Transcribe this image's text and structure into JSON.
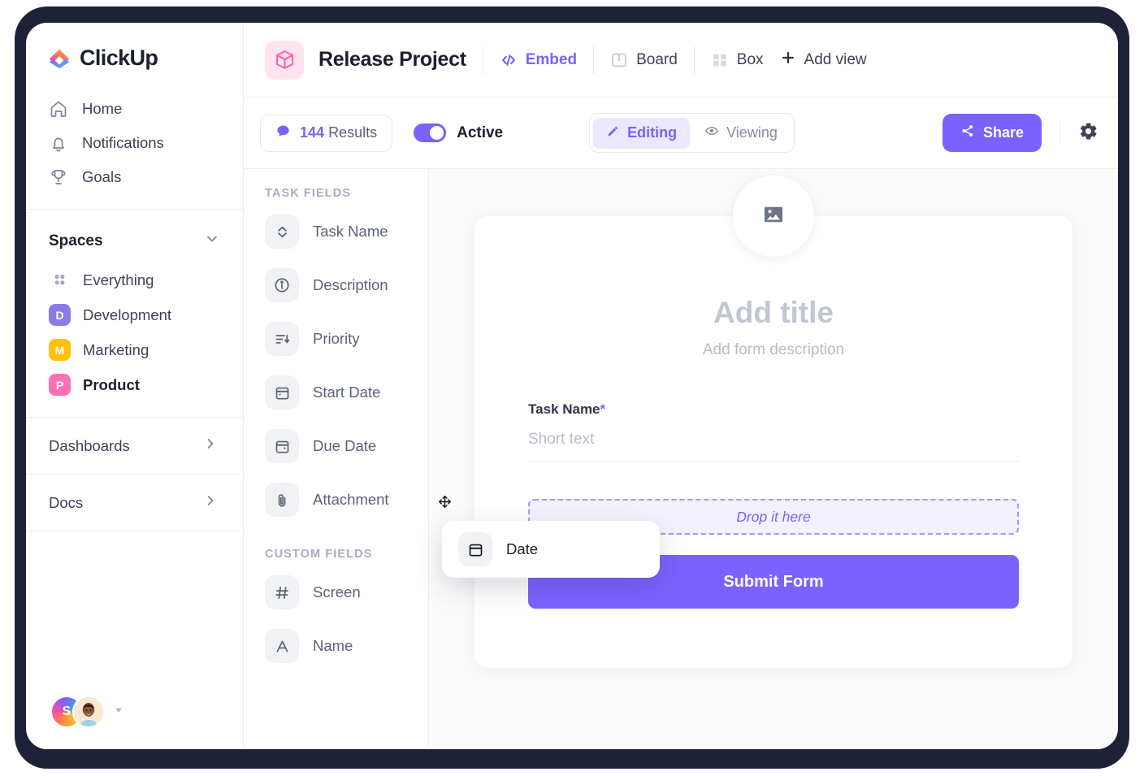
{
  "app": {
    "brand": "ClickUp"
  },
  "sidebar": {
    "nav": [
      {
        "label": "Home",
        "icon": "home-icon"
      },
      {
        "label": "Notifications",
        "icon": "bell-icon"
      },
      {
        "label": "Goals",
        "icon": "trophy-icon"
      }
    ],
    "spaces_title": "Spaces",
    "spaces": [
      {
        "label": "Everything",
        "badge": "",
        "color": "",
        "active": false,
        "icon": "grid-dots-icon"
      },
      {
        "label": "Development",
        "badge": "D",
        "color": "#8C7AE6",
        "active": false
      },
      {
        "label": "Marketing",
        "badge": "M",
        "color": "#FFC107",
        "active": false
      },
      {
        "label": "Product",
        "badge": "P",
        "color": "#FF6FB5",
        "active": true
      }
    ],
    "sections": [
      {
        "label": "Dashboards"
      },
      {
        "label": "Docs"
      }
    ],
    "avatars": {
      "initial": "S"
    }
  },
  "header": {
    "project_title": "Release Project",
    "views": [
      {
        "label": "Embed",
        "icon": "code-icon",
        "active": true
      },
      {
        "label": "Board",
        "icon": "board-icon",
        "active": false
      },
      {
        "label": "Box",
        "icon": "box-grid-icon",
        "active": false
      }
    ],
    "add_view": "Add view"
  },
  "toolbar": {
    "results_count": "144",
    "results_label": "Results",
    "active_label": "Active",
    "active_on": true,
    "modes": [
      {
        "label": "Editing",
        "icon": "pencil-icon",
        "active": true
      },
      {
        "label": "Viewing",
        "icon": "eye-icon",
        "active": false
      }
    ],
    "share_label": "Share"
  },
  "fields_panel": {
    "task_fields_title": "TASK FIELDS",
    "task_fields": [
      {
        "label": "Task Name",
        "icon": "chevron-updown-icon"
      },
      {
        "label": "Description",
        "icon": "info-circle-icon"
      },
      {
        "label": "Priority",
        "icon": "sort-desc-icon"
      },
      {
        "label": "Start Date",
        "icon": "calendar-icon"
      },
      {
        "label": "Due Date",
        "icon": "calendar-icon"
      },
      {
        "label": "Attachment",
        "icon": "paperclip-icon"
      }
    ],
    "custom_fields_title": "CUSTOM FIELDS",
    "custom_fields": [
      {
        "label": "Screen",
        "icon": "hash-icon"
      },
      {
        "label": "Name",
        "icon": "letter-a-icon"
      }
    ]
  },
  "form": {
    "title_placeholder": "Add title",
    "description_placeholder": "Add form description",
    "task_name_label": "Task Name",
    "required_mark": "*",
    "short_text_placeholder": "Short text",
    "dropzone_label": "Drop it here",
    "submit_label": "Submit Form"
  },
  "drag": {
    "card_label": "Date",
    "card_icon": "calendar-icon"
  },
  "colors": {
    "accent": "#7B61FF",
    "accent_soft": "#ECE8FF",
    "dropzone_bg": "#F4F1FF",
    "frame": "#1D2238",
    "pink": "#FF6FB5",
    "amber": "#FFC107",
    "purple_space": "#8C7AE6"
  }
}
